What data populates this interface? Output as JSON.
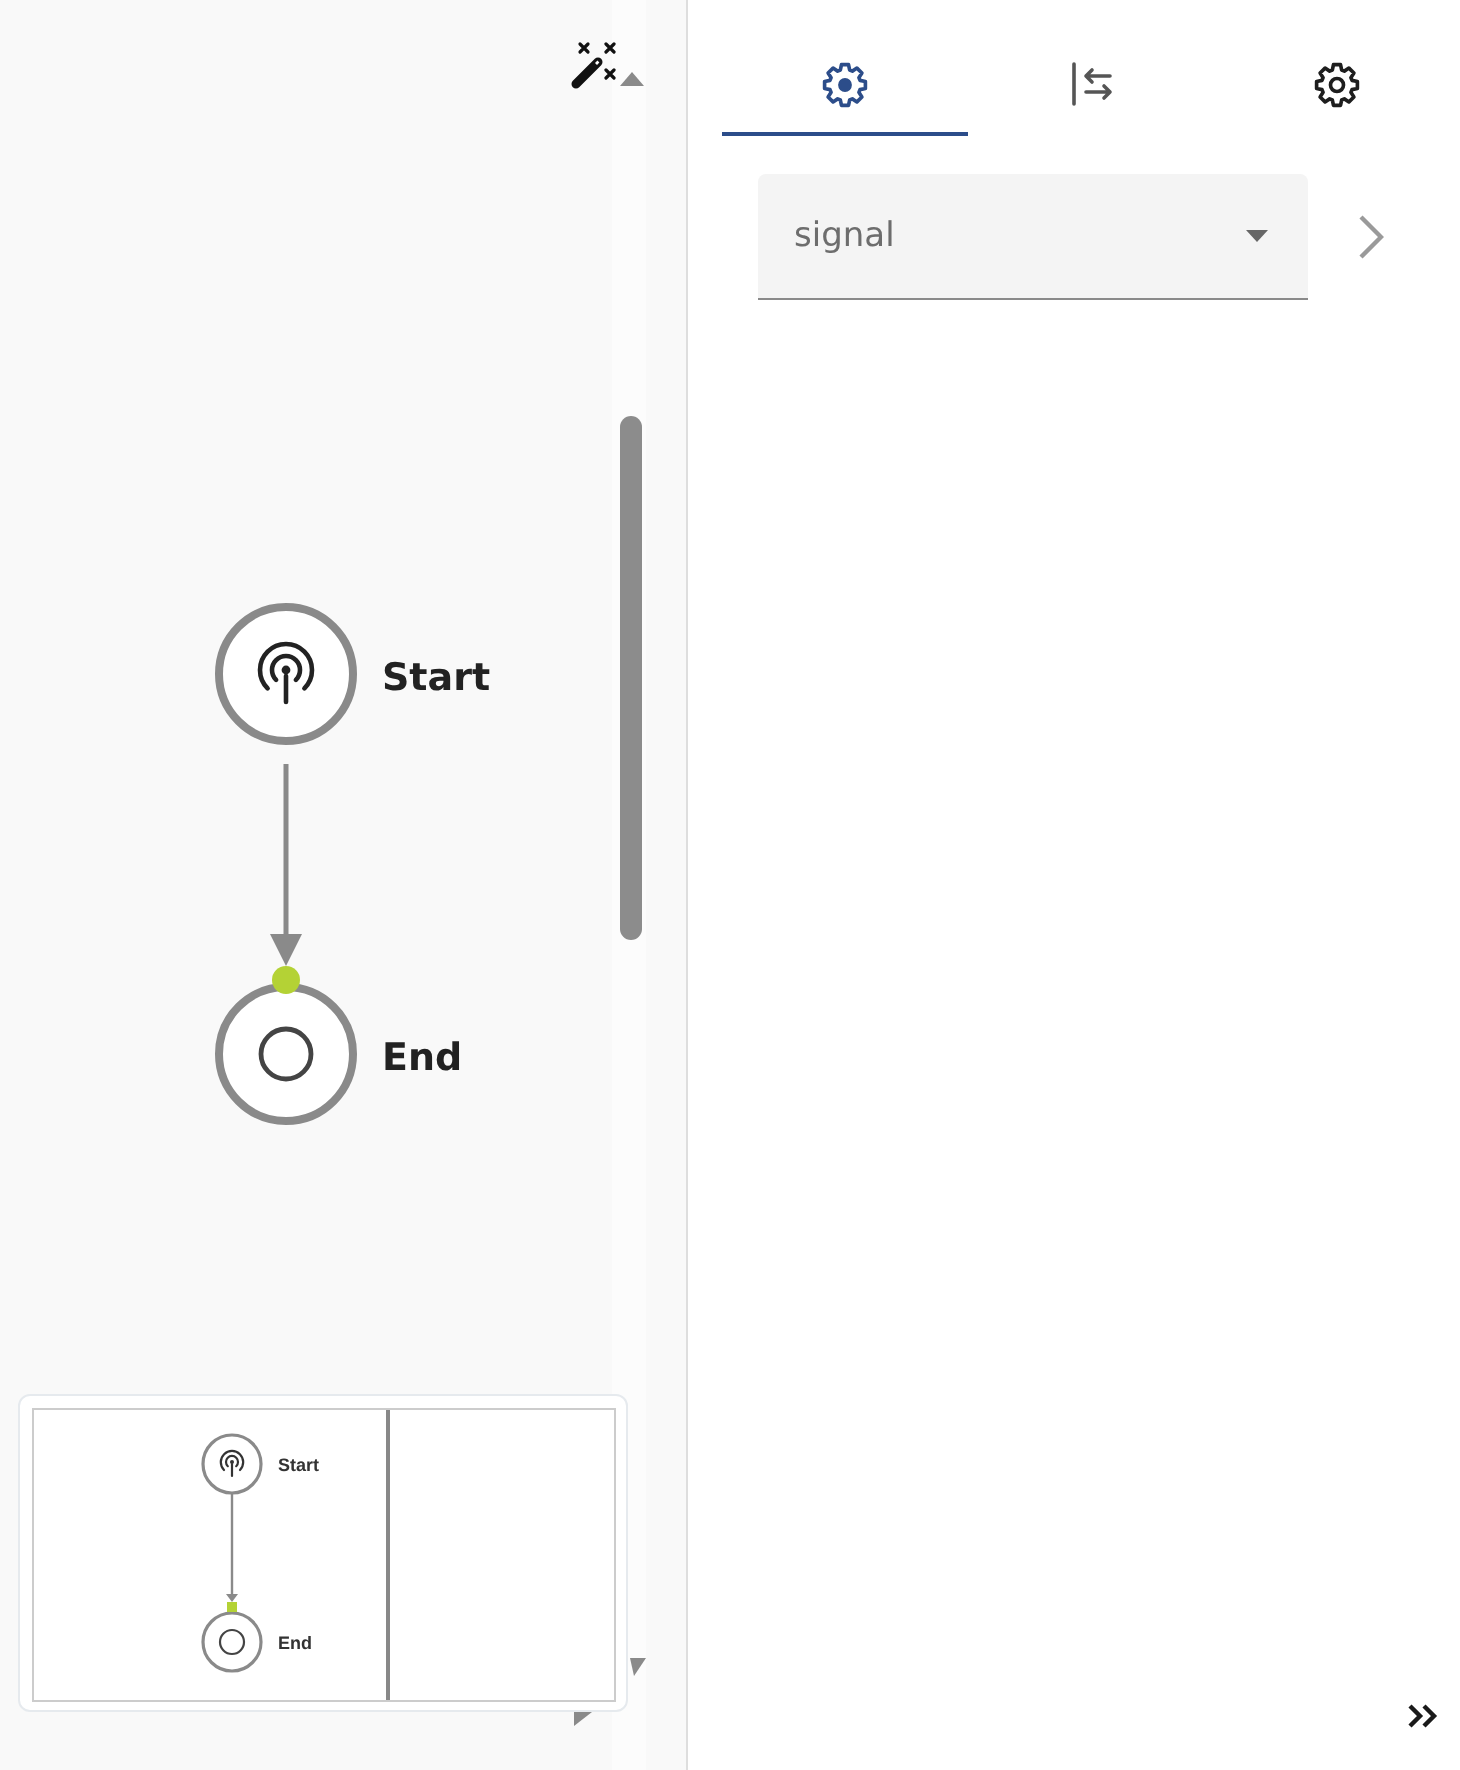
{
  "canvas": {
    "nodes": [
      {
        "kind": "signal",
        "label": "Start"
      },
      {
        "kind": "end",
        "label": "End"
      }
    ]
  },
  "minimap": {
    "nodes": [
      {
        "kind": "signal",
        "label": "Start"
      },
      {
        "kind": "end",
        "label": "End"
      }
    ]
  },
  "panel": {
    "tabs": [
      {
        "kind": "gearfilled",
        "selected": true
      },
      {
        "kind": "swap",
        "selected": false
      },
      {
        "kind": "gear",
        "selected": false
      }
    ],
    "type_select": {
      "value": "signal"
    }
  }
}
